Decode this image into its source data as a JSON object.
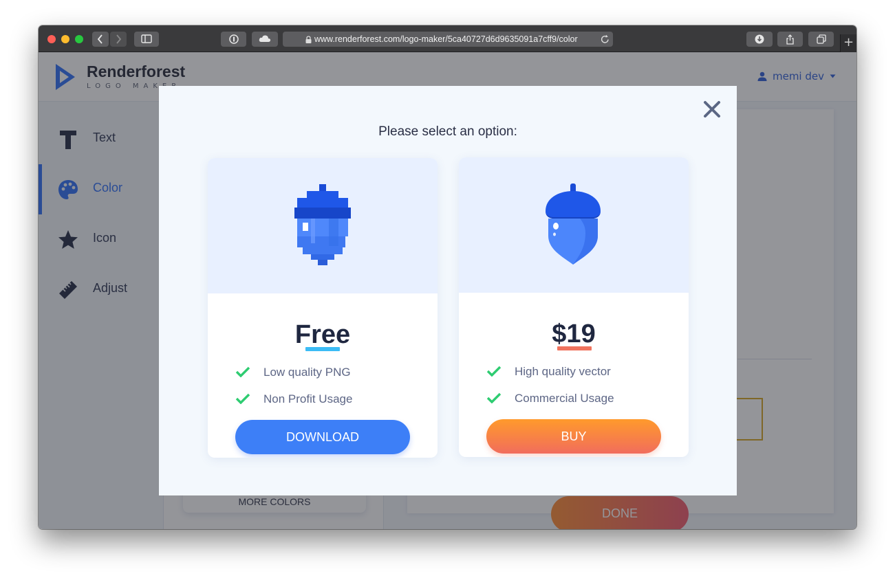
{
  "browser": {
    "url": "www.renderforest.com/logo-maker/5ca40727d6d9635091a7cff9/color",
    "new_tab": "+"
  },
  "app": {
    "brand_name": "Renderforest",
    "brand_sub": "LOGO MAKER",
    "user_name": "memi dev"
  },
  "sidebar": {
    "items": [
      {
        "label": "Text",
        "icon": "text-icon"
      },
      {
        "label": "Color",
        "icon": "palette-icon",
        "active": true
      },
      {
        "label": "Icon",
        "icon": "star-icon"
      },
      {
        "label": "Adjust",
        "icon": "ruler-icon"
      }
    ]
  },
  "panel": {
    "more_colors": "MORE COLORS"
  },
  "canvas": {
    "done": "DONE"
  },
  "modal": {
    "title": "Please select an option:",
    "free": {
      "price": "Free",
      "features": [
        "Low quality PNG",
        "Non Profit Usage"
      ],
      "button": "DOWNLOAD"
    },
    "paid": {
      "price": "$19",
      "features": [
        "High quality vector",
        "Commercial Usage"
      ],
      "button": "BUY"
    }
  },
  "colors": {
    "accent_blue": "#3d7ff7",
    "accent_orange": "#ff9a2c",
    "check_green": "#2ecc71"
  }
}
